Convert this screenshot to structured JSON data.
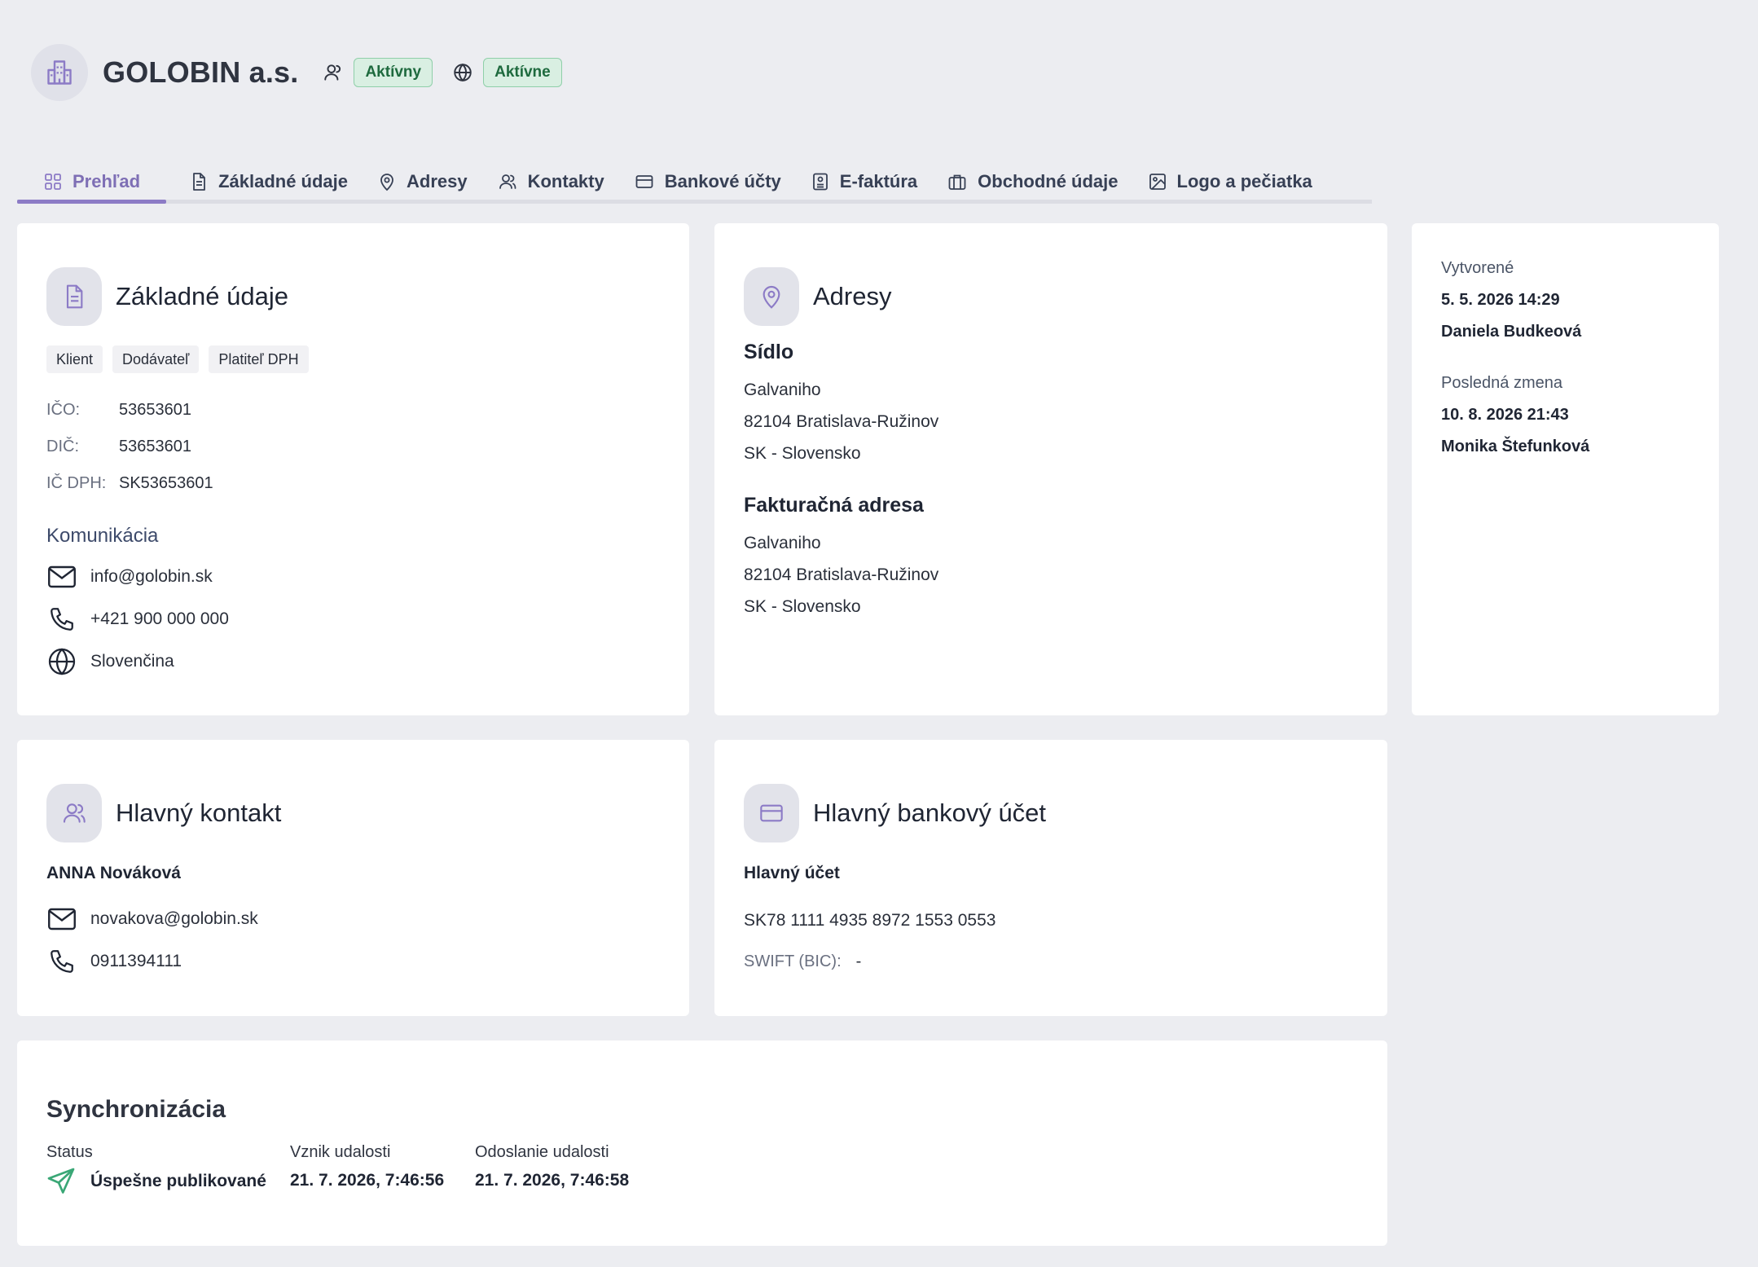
{
  "header": {
    "company_name": "GOLOBIN a.s.",
    "status_badge": "Aktívny",
    "web_badge": "Aktívne",
    "badge_color": "#d9efe2"
  },
  "tabs": [
    {
      "label": "Prehľad",
      "icon": "grid-icon",
      "active": true
    },
    {
      "label": "Základné údaje",
      "icon": "document-icon"
    },
    {
      "label": "Adresy",
      "icon": "map-pin-icon"
    },
    {
      "label": "Kontakty",
      "icon": "users-icon"
    },
    {
      "label": "Bankové účty",
      "icon": "credit-card-icon"
    },
    {
      "label": "E-faktúra",
      "icon": "invoice-icon"
    },
    {
      "label": "Obchodné údaje",
      "icon": "briefcase-icon"
    },
    {
      "label": "Logo a pečiatka",
      "icon": "image-icon"
    }
  ],
  "basic": {
    "title": "Základné údaje",
    "chips": [
      "Klient",
      "Dodávateľ",
      "Platiteľ DPH"
    ],
    "ico_label": "IČO:",
    "ico": "53653601",
    "dic_label": "DIČ:",
    "dic": "53653601",
    "icdph_label": "IČ DPH:",
    "icdph": "SK53653601",
    "communication_label": "Komunikácia",
    "email": "info@golobin.sk",
    "phone": "+421 900 000 000",
    "language": "Slovenčina"
  },
  "addresses": {
    "title": "Adresy",
    "seat": {
      "label": "Sídlo",
      "street": "Galvaniho",
      "city": "82104 Bratislava-Ružinov",
      "country": "SK - Slovensko"
    },
    "billing": {
      "label": "Fakturačná adresa",
      "street": "Galvaniho",
      "city": "82104 Bratislava-Ružinov",
      "country": "SK - Slovensko"
    }
  },
  "meta": {
    "created_label": "Vytvorené",
    "created_at": "5. 5. 2026 14:29",
    "created_by": "Daniela Budkeová",
    "modified_label": "Posledná zmena",
    "modified_at": "10. 8. 2026 21:43",
    "modified_by": "Monika Štefunková"
  },
  "contact": {
    "title": "Hlavný kontakt",
    "name": "ANNA Nováková",
    "email": "novakova@golobin.sk",
    "phone": "0911394111"
  },
  "bank": {
    "title": "Hlavný bankový účet",
    "account_name": "Hlavný účet",
    "iban": "SK78 1111 4935 8972 1553 0553",
    "swift_label": "SWIFT (BIC):",
    "swift": "-"
  },
  "sync": {
    "title": "Synchronizácia",
    "status_label": "Status",
    "status": "Úspešne publikované",
    "event_created_label": "Vznik udalosti",
    "event_created": "21. 7. 2026, 7:46:56",
    "event_sent_label": "Odoslanie udalosti",
    "event_sent": "21. 7. 2026, 7:46:58",
    "success_color": "#3aa776"
  }
}
